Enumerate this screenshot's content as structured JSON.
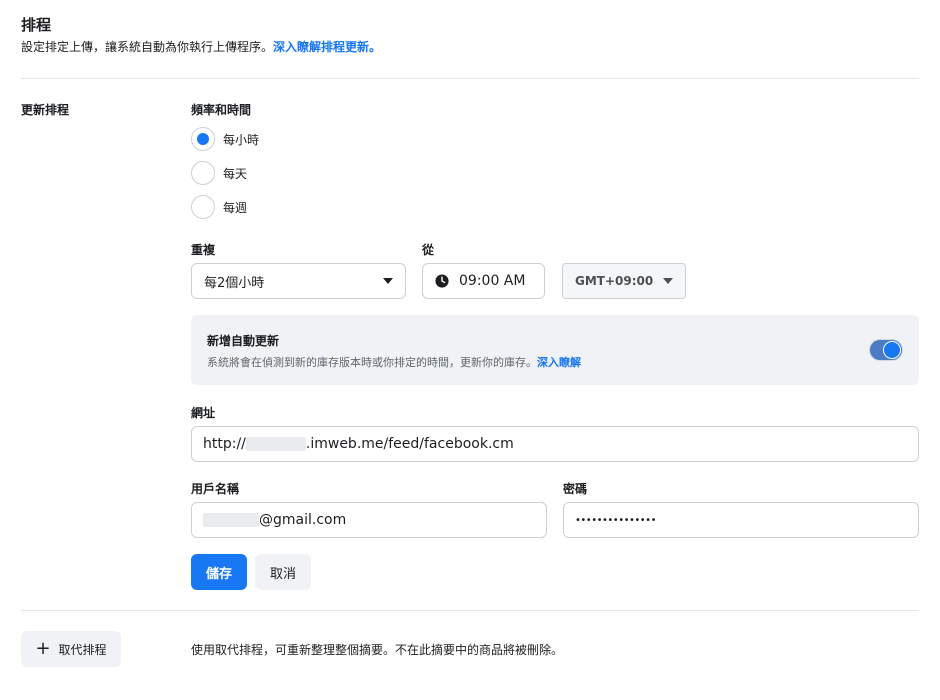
{
  "header": {
    "title": "排程",
    "description": "設定排定上傳，讓系統自動為你執行上傳程序。",
    "learn_more": "深入瞭解排程更新。"
  },
  "update_schedule": {
    "section_label": "更新排程",
    "frequency_label": "頻率和時間",
    "options": [
      {
        "label": "每小時",
        "checked": true
      },
      {
        "label": "每天",
        "checked": false
      },
      {
        "label": "每週",
        "checked": false
      }
    ],
    "repeat_label": "重複",
    "repeat_value": "每2個小時",
    "from_label": "從",
    "time_value": "09:00 AM",
    "timezone_value": "GMT+09:00"
  },
  "auto_update": {
    "title": "新增自動更新",
    "description": "系統將會在偵測到新的庫存版本時或你排定的時間，更新你的庫存。",
    "learn_more": "深入瞭解",
    "enabled": true
  },
  "url": {
    "label": "網址",
    "prefix": "http://",
    "suffix": ".imweb.me/feed/facebook.cm"
  },
  "credentials": {
    "username_label": "用戶名稱",
    "username_suffix": "@gmail.com",
    "password_label": "密碼",
    "password_mask": "•••••••••••••••"
  },
  "actions": {
    "save": "儲存",
    "cancel": "取消"
  },
  "replace": {
    "button_label": "取代排程",
    "description": "使用取代排程，可重新整理整個摘要。不在此摘要中的商品將被刪除。"
  },
  "colors": {
    "accent": "#1877f2",
    "panel": "#f0f2f5"
  }
}
